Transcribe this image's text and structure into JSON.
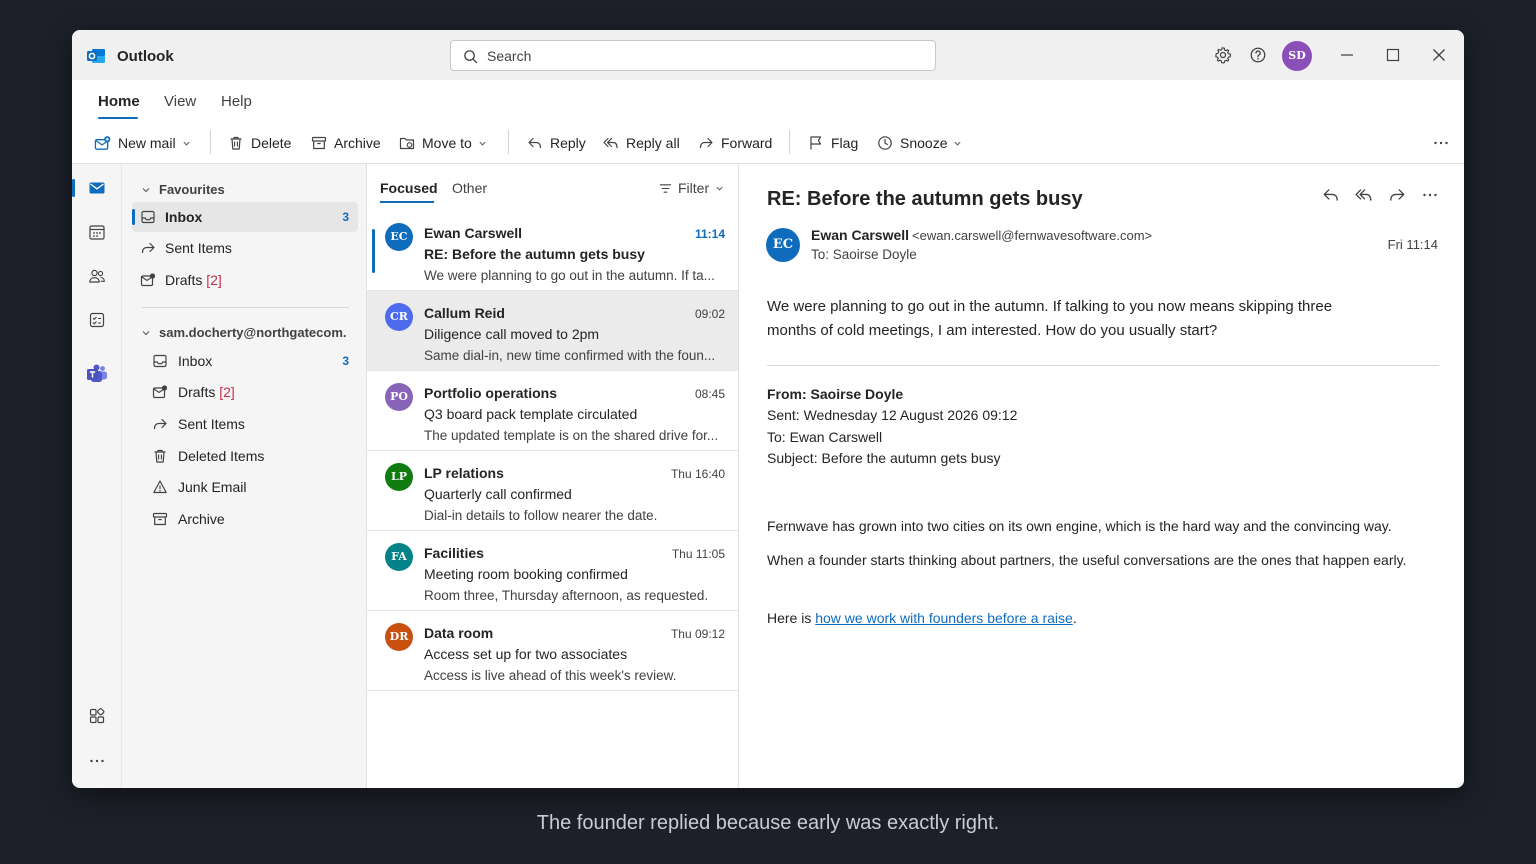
{
  "app": {
    "title": "Outlook",
    "logo_icon": "outlook-logo-icon",
    "accent": "#0f6cbd"
  },
  "search": {
    "placeholder": "Search"
  },
  "user": {
    "initials": "SD",
    "avatar_color": "#8a4fb8"
  },
  "ribbon": {
    "tabs": [
      {
        "label": "Home"
      },
      {
        "label": "View"
      },
      {
        "label": "Help"
      }
    ],
    "commands": {
      "new_mail": "New mail",
      "delete": "Delete",
      "archive": "Archive",
      "move_to": "Move to",
      "reply": "Reply",
      "reply_all": "Reply all",
      "forward": "Forward",
      "flag": "Flag",
      "snooze": "Snooze"
    }
  },
  "folders": {
    "favourites": {
      "header": "Favourites",
      "items": [
        {
          "label": "Inbox",
          "count": "3"
        },
        {
          "label": "Sent Items"
        },
        {
          "label": "Drafts",
          "badge": "[2]"
        }
      ]
    },
    "account": {
      "header": "sam.docherty@northgatecom.",
      "items": [
        {
          "label": "Inbox",
          "count": "3"
        },
        {
          "label": "Drafts",
          "badge": "[2]"
        },
        {
          "label": "Sent Items"
        },
        {
          "label": "Deleted Items"
        },
        {
          "label": "Junk Email"
        },
        {
          "label": "Archive"
        }
      ]
    }
  },
  "list": {
    "tabs": [
      {
        "label": "Focused"
      },
      {
        "label": "Other"
      }
    ],
    "filter_label": "Filter",
    "messages": [
      {
        "initials": "EC",
        "color": "#0f6cbd",
        "sender": "Ewan Carswell",
        "time": "11:14",
        "subject": "RE: Before the autumn gets busy",
        "preview": "We were planning to go out in the autumn. If ta..."
      },
      {
        "initials": "CR",
        "color": "#4f6bed",
        "sender": "Callum Reid",
        "time": "09:02",
        "subject": "Diligence call moved to 2pm",
        "preview": "Same dial-in, new time confirmed with the foun..."
      },
      {
        "initials": "PO",
        "color": "#8764b8",
        "sender": "Portfolio operations",
        "time": "08:45",
        "subject": "Q3 board pack template circulated",
        "preview": "The updated template is on the shared drive for..."
      },
      {
        "initials": "LP",
        "color": "#107c10",
        "sender": "LP relations",
        "time": "Thu 16:40",
        "subject": "Quarterly call confirmed",
        "preview": "Dial-in details to follow nearer the date."
      },
      {
        "initials": "FA",
        "color": "#038387",
        "sender": "Facilities",
        "time": "Thu 11:05",
        "subject": "Meeting room booking confirmed",
        "preview": "Room three, Thursday afternoon, as requested."
      },
      {
        "initials": "DR",
        "color": "#ca5010",
        "sender": "Data room",
        "time": "Thu 09:12",
        "subject": "Access set up for two associates",
        "preview": "Access is live ahead of this week's review."
      }
    ]
  },
  "reading": {
    "subject": "RE: Before the autumn gets busy",
    "sender_initials": "EC",
    "sender_name": "Ewan Carswell",
    "sender_address": "<ewan.carswell@fernwavesoftware.com>",
    "to_line": "To: Saoirse Doyle",
    "date": "Fri 11:14",
    "body": "We were planning to go out in the autumn. If talking to you now means skipping three months of cold meetings, I am interested. How do you usually start?",
    "quoted": {
      "from": "From: Saoirse Doyle",
      "sent": "Sent: Wednesday 12 August 2026 09:12",
      "to": "To: Ewan Carswell",
      "subject": "Subject: Before the autumn gets busy",
      "p1": "Fernwave has grown into two cities on its own engine, which is the hard way and the convincing way.",
      "p2": "When a founder starts thinking about partners, the useful conversations are the ones that happen early.",
      "p3_prefix": "Here is ",
      "p3_link": "how we work with founders before a raise",
      "p3_suffix": "."
    }
  },
  "caption": "The founder replied because early was exactly right."
}
